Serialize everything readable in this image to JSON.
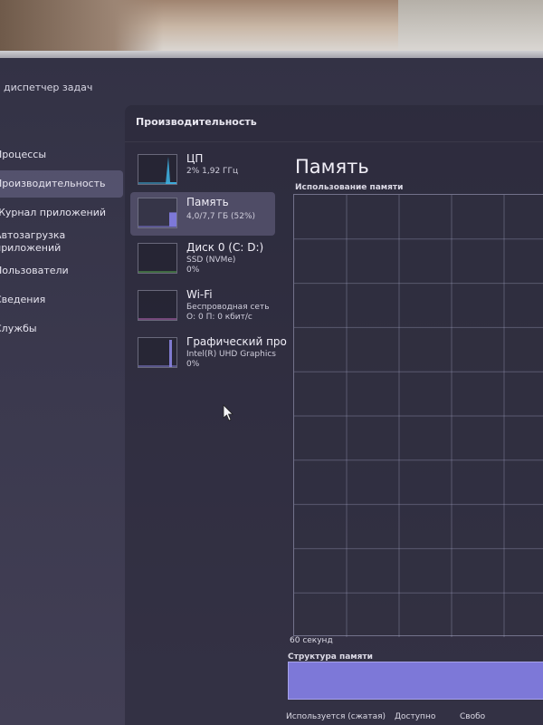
{
  "app": {
    "title": "диспетчер задач"
  },
  "nav": {
    "items": [
      {
        "label": "Процессы"
      },
      {
        "label": "Производительность",
        "active": true
      },
      {
        "label": "Журнал приложений"
      },
      {
        "label": "Автозагрузка\nприложений"
      },
      {
        "label": "Пользователи"
      },
      {
        "label": "Сведения"
      },
      {
        "label": "Службы"
      }
    ]
  },
  "panel": {
    "header": "Производительность"
  },
  "devices": [
    {
      "name": "ЦП",
      "line1": "2% 1,92 ГГц",
      "line2": "",
      "usage": 0.02
    },
    {
      "name": "Память",
      "line1": "4,0/7,7 ГБ (52%)",
      "line2": "",
      "usage": 0.52,
      "active": true
    },
    {
      "name": "Диск 0 (C: D:)",
      "line1": "SSD (NVMe)",
      "line2": "0%",
      "usage": 0
    },
    {
      "name": "Wi-Fi",
      "line1": "Беспроводная сеть",
      "line2": "О: 0 П: 0 кбит/с",
      "usage": 0
    },
    {
      "name": "Графический про",
      "line1": "Intel(R) UHD Graphics",
      "line2": "0%",
      "usage": 0
    }
  ],
  "main": {
    "title": "Память",
    "graph_label": "Использование памяти",
    "time_label": "60 секунд",
    "structure_label": "Структура памяти",
    "legend": {
      "used": "Используется (сжатая)",
      "available": "Доступно",
      "free": "Свобо"
    }
  },
  "colors": {
    "accent_memory": "#7d78d8",
    "accent_cpu": "#3fb6e8"
  }
}
